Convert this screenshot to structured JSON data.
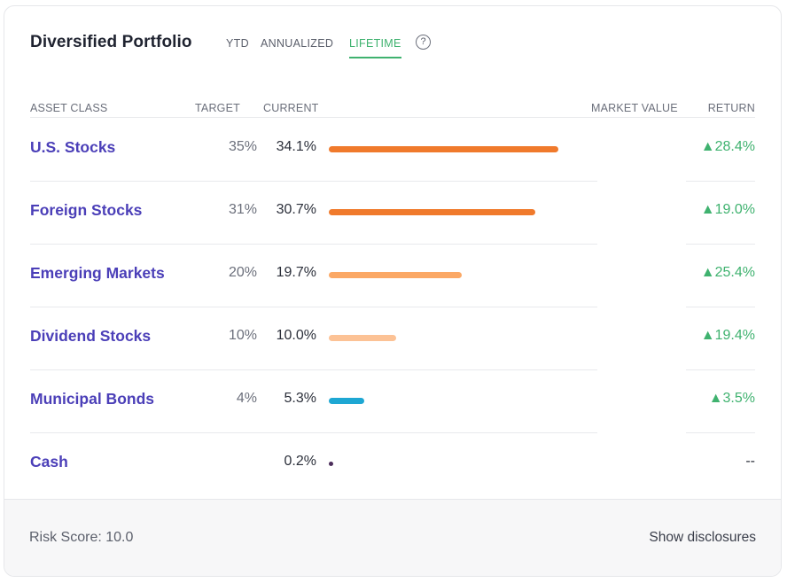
{
  "header": {
    "title": "Diversified Portfolio",
    "tabs": [
      "YTD",
      "ANNUALIZED",
      "LIFETIME"
    ],
    "active_tab": "LIFETIME",
    "help_icon": "?"
  },
  "columns": {
    "asset": "ASSET CLASS",
    "target": "TARGET",
    "current": "CURRENT",
    "market_value": "MARKET VALUE",
    "return": "RETURN"
  },
  "rows": [
    {
      "name": "U.S. Stocks",
      "target": "35%",
      "current": "34.1%",
      "return": "▲28.4%",
      "bar_fraction": 0.341,
      "color": "#f07a2c"
    },
    {
      "name": "Foreign Stocks",
      "target": "31%",
      "current": "30.7%",
      "return": "▲19.0%",
      "bar_fraction": 0.307,
      "color": "#f07a2c"
    },
    {
      "name": "Emerging Markets",
      "target": "20%",
      "current": "19.7%",
      "return": "▲25.4%",
      "bar_fraction": 0.197,
      "color": "#fba865"
    },
    {
      "name": "Dividend Stocks",
      "target": "10%",
      "current": "10.0%",
      "return": "▲19.4%",
      "bar_fraction": 0.1,
      "color": "#fcc295"
    },
    {
      "name": "Municipal Bonds",
      "target": "4%",
      "current": "5.3%",
      "return": "▲3.5%",
      "bar_fraction": 0.053,
      "color": "#1ea7d3"
    },
    {
      "name": "Cash",
      "target": "",
      "current": "0.2%",
      "return": "--",
      "bar_fraction": 0.002,
      "color": "#4b2d5b"
    }
  ],
  "footer": {
    "risk_score": "Risk Score: 10.0",
    "disclosures": "Show disclosures"
  },
  "colors": {
    "accent_green": "#3fb26f",
    "link_purple": "#4b3fb8"
  }
}
